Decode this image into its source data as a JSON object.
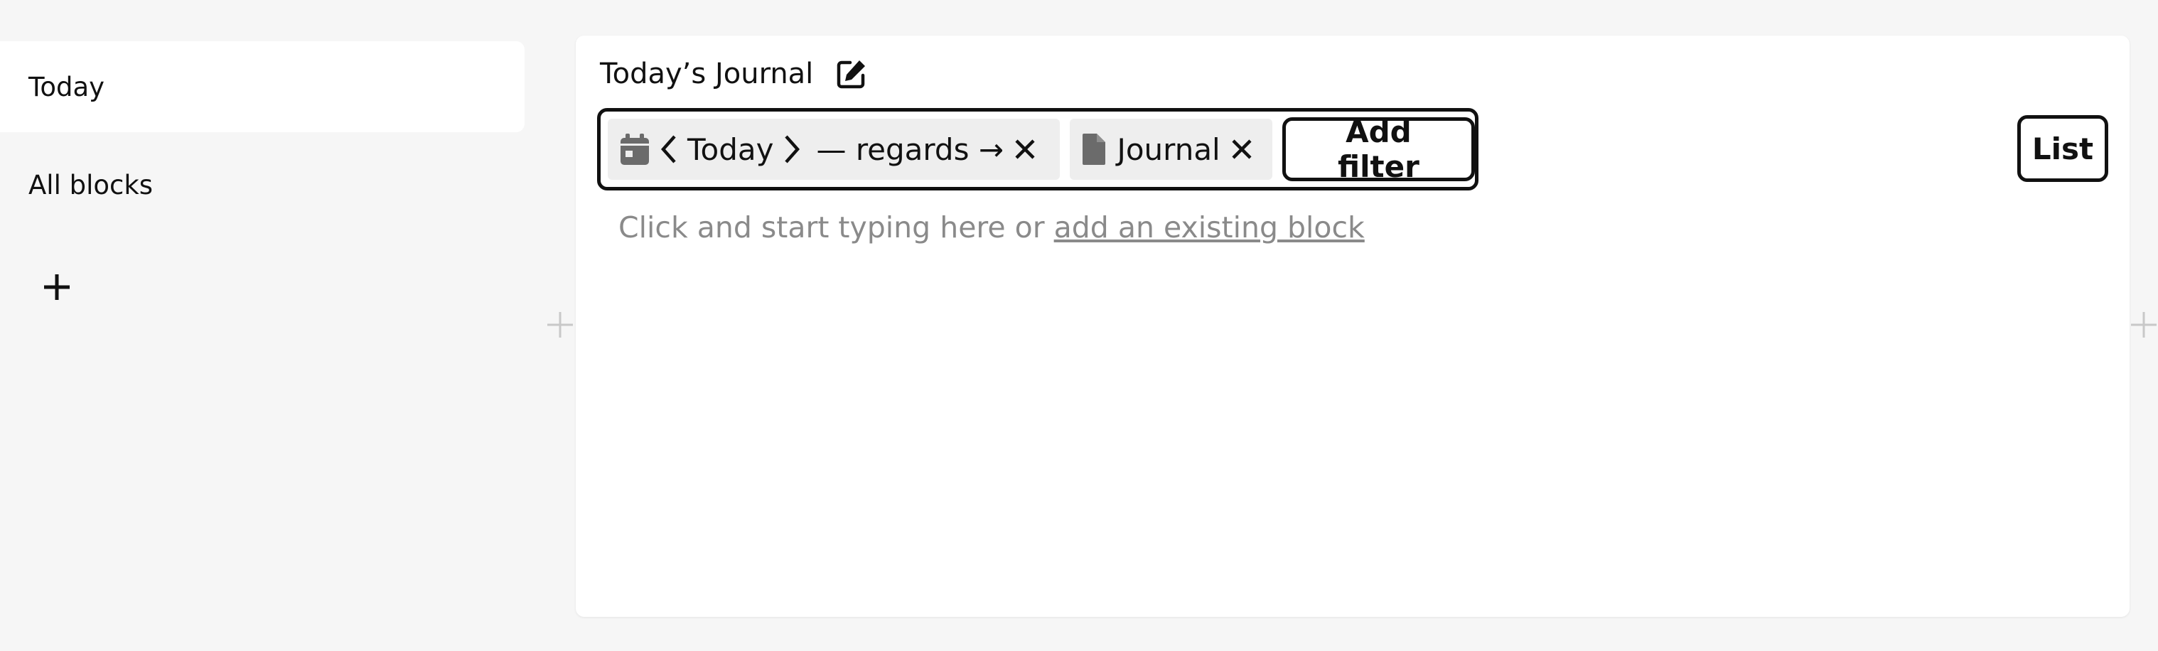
{
  "sidebar": {
    "items": [
      {
        "label": "Today",
        "active": true
      },
      {
        "label": "All blocks",
        "active": false
      }
    ],
    "add_icon": "plus-icon"
  },
  "panel": {
    "title": "Today’s Journal",
    "edit_icon": "edit-icon",
    "filters": {
      "date_chip": {
        "icon": "calendar-icon",
        "prev_icon": "chevron-left-icon",
        "label": "Today",
        "next_icon": "chevron-right-icon",
        "relation": "— regards →",
        "remove_icon": "close-icon"
      },
      "type_chip": {
        "icon": "document-icon",
        "label": "Journal",
        "remove_icon": "close-icon"
      },
      "add_filter_label": "Add filter"
    },
    "view_button_label": "List",
    "hint_prefix": "Click and start typing here or ",
    "hint_link": "add an existing block"
  },
  "colors": {
    "background": "#f6f6f6",
    "panel": "#ffffff",
    "text": "#111111",
    "hint": "#8a8a8a",
    "chip": "#eeeeee",
    "icon_gray": "#6b6b6b"
  }
}
